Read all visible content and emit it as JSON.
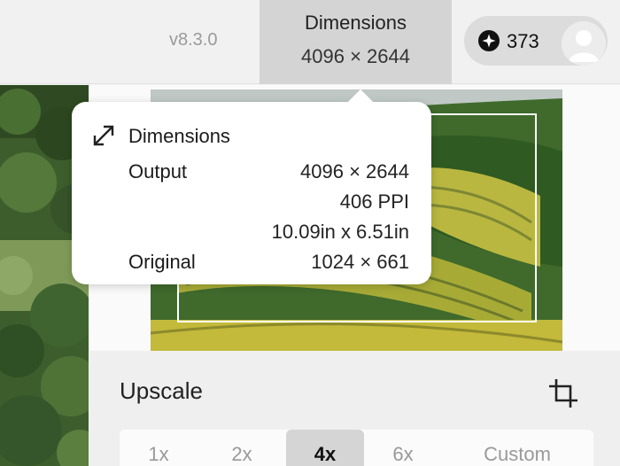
{
  "header": {
    "version": "v8.3.0",
    "dimensions_tab": {
      "label": "Dimensions",
      "value": "4096 × 2644"
    },
    "credits": {
      "count": "373",
      "icon": "coin-star-icon"
    },
    "avatar": {
      "icon": "user-avatar-icon"
    }
  },
  "tooltip": {
    "title": "Dimensions",
    "icon": "expand-diagonal-icon",
    "output_label": "Output",
    "output_size": "4096 × 2644",
    "ppi": "406 PPI",
    "inches": "10.09in x 6.51in",
    "original_label": "Original",
    "original_size": "1024 × 661"
  },
  "upscale": {
    "title": "Upscale",
    "crop_icon": "crop-icon",
    "options": [
      "1x",
      "2x",
      "4x",
      "6x",
      "Custom"
    ],
    "selected": "4x"
  },
  "colors": {
    "active_tab_bg": "#d4d4d4",
    "panel_bg": "#efefef"
  }
}
